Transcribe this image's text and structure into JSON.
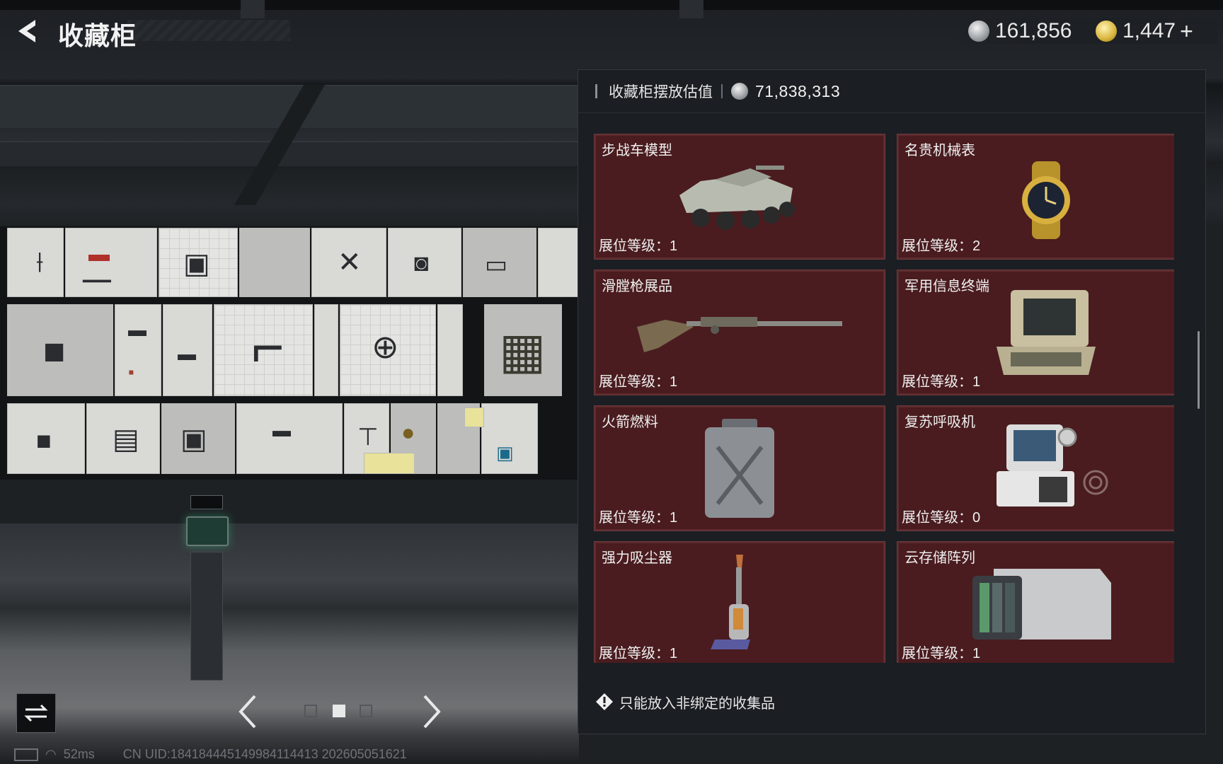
{
  "header": {
    "title": "收藏柜",
    "currencies": [
      {
        "icon": "silver-coin-icon",
        "value": "161,856"
      },
      {
        "icon": "gold-coin-icon",
        "value": "1,447",
        "has_plus": true,
        "plus": "+"
      }
    ]
  },
  "panel": {
    "header_label": "收藏柜摆放估值",
    "header_icon": "silver-coin-icon",
    "header_value": "71,838,313",
    "cards": [
      {
        "name": "步战车模型",
        "level_label": "展位等级：",
        "level": "1",
        "icon": "armored-vehicle-model"
      },
      {
        "name": "名贵机械表",
        "level_label": "展位等级：",
        "level": "2",
        "icon": "gold-watch"
      },
      {
        "name": "滑膛枪展品",
        "level_label": "展位等级：",
        "level": "1",
        "icon": "musket"
      },
      {
        "name": "军用信息终端",
        "level_label": "展位等级：",
        "level": "1",
        "icon": "military-terminal"
      },
      {
        "name": "火箭燃料",
        "level_label": "展位等级：",
        "level": "1",
        "icon": "fuel-canister"
      },
      {
        "name": "复苏呼吸机",
        "level_label": "展位等级：",
        "level": "0",
        "icon": "ventilator"
      },
      {
        "name": "强力吸尘器",
        "level_label": "展位等级：",
        "level": "1",
        "icon": "vacuum-cleaner"
      },
      {
        "name": "云存储阵列",
        "level_label": "展位等级：",
        "level": "1",
        "icon": "storage-array"
      }
    ],
    "footer_note": "只能放入非绑定的收集品"
  },
  "pager": {
    "pages": 3,
    "active": 2
  },
  "status": {
    "ping": "52ms",
    "uid_text": "CN UID:1841844451499841144​13 202605051621"
  },
  "colors": {
    "card_bg": "#4a1c1f",
    "panel_bg": "#1b1e22",
    "accent_text": "#f0f0f0"
  }
}
